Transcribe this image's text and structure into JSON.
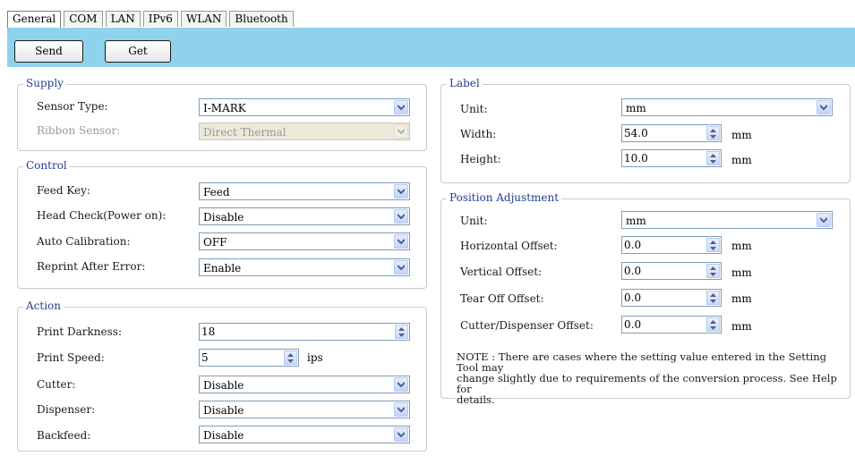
{
  "tabs": [
    "General",
    "COM",
    "LAN",
    "IPv6",
    "WLAN",
    "Bluetooth"
  ],
  "toolbar": {
    "send_label": "Send",
    "get_label": "Get",
    "background": "#8fd2ec"
  },
  "supply": {
    "title": "Supply",
    "sensor_type": {
      "label": "Sensor Type:",
      "value": "I-MARK"
    },
    "ribbon_sensor": {
      "label": "Ribbon Sensor:",
      "value": "Direct Thermal"
    }
  },
  "control": {
    "title": "Control",
    "feed_key": {
      "label": "Feed Key:",
      "value": "Feed"
    },
    "head_check": {
      "label": "Head Check(Power on):",
      "value": "Disable"
    },
    "auto_calibration": {
      "label": "Auto Calibration:",
      "value": "OFF"
    },
    "reprint": {
      "label": "Reprint After Error:",
      "value": "Enable"
    }
  },
  "action": {
    "title": "Action",
    "print_darkness": {
      "label": "Print Darkness:",
      "value": "18"
    },
    "print_speed": {
      "label": "Print Speed:",
      "value": "5",
      "unit": "ips"
    },
    "cutter": {
      "label": "Cutter:",
      "value": "Disable"
    },
    "dispenser": {
      "label": "Dispenser:",
      "value": "Disable"
    },
    "backfeed": {
      "label": "Backfeed:",
      "value": "Disable"
    }
  },
  "label": {
    "title": "Label",
    "unit": {
      "label": "Unit:",
      "value": "mm"
    },
    "width": {
      "label": "Width:",
      "value": "54.0",
      "unit": "mm"
    },
    "height": {
      "label": "Height:",
      "value": "10.0",
      "unit": "mm"
    }
  },
  "position": {
    "title": "Position Adjustment",
    "unit": {
      "label": "Unit:",
      "value": "mm"
    },
    "horizontal": {
      "label": "Horizontal Offset:",
      "value": "0.0",
      "unit": "mm"
    },
    "vertical": {
      "label": "Vertical Offset:",
      "value": "0.0",
      "unit": "mm"
    },
    "tearoff": {
      "label": "Tear Off Offset:",
      "value": "0.0",
      "unit": "mm"
    },
    "cutter": {
      "label": "Cutter/Dispenser Offset:",
      "value": "0.0",
      "unit": "mm"
    },
    "note": [
      "NOTE : There are cases where the setting value entered in the Setting Tool may",
      "change slightly due to requirements of the conversion process. See Help for",
      "details."
    ]
  }
}
